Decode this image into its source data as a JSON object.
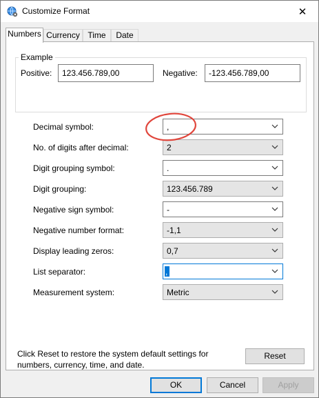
{
  "window": {
    "title": "Customize Format",
    "close_glyph": "✕"
  },
  "tabs": [
    {
      "label": "Numbers",
      "active": true
    },
    {
      "label": "Currency",
      "active": false
    },
    {
      "label": "Time",
      "active": false
    },
    {
      "label": "Date",
      "active": false
    }
  ],
  "example": {
    "legend": "Example",
    "positive_label": "Positive:",
    "positive_value": "123.456.789,00",
    "negative_label": "Negative:",
    "negative_value": "-123.456.789,00"
  },
  "settings": [
    {
      "label": "Decimal symbol:",
      "value": ",",
      "enabled": true
    },
    {
      "label": "No. of digits after decimal:",
      "value": "2",
      "enabled": false
    },
    {
      "label": "Digit grouping symbol:",
      "value": ".",
      "enabled": true
    },
    {
      "label": "Digit grouping:",
      "value": "123.456.789",
      "enabled": false
    },
    {
      "label": "Negative sign symbol:",
      "value": "-",
      "enabled": true
    },
    {
      "label": "Negative number format:",
      "value": "-1,1",
      "enabled": false
    },
    {
      "label": "Display leading zeros:",
      "value": "0,7",
      "enabled": false
    },
    {
      "label": "List separator:",
      "value": ",",
      "enabled": true,
      "focused": true
    },
    {
      "label": "Measurement system:",
      "value": "Metric",
      "enabled": false
    }
  ],
  "footer": {
    "info": "Click Reset to restore the system default settings for numbers, currency, time, and date.",
    "reset_label": "Reset",
    "ok_label": "OK",
    "cancel_label": "Cancel",
    "apply_label": "Apply"
  },
  "colors": {
    "annotation": "#e0463c",
    "focus": "#0078d7"
  },
  "icons": {
    "title": "globe-settings-icon",
    "combo_arrow": "chevron-down-icon"
  }
}
